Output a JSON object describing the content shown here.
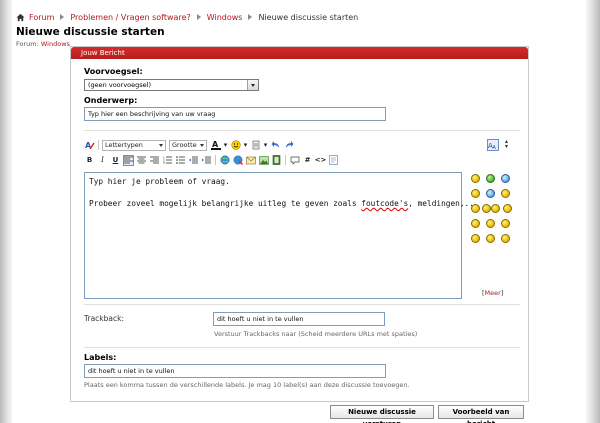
{
  "breadcrumb": {
    "items": [
      "Forum",
      "Problemen / Vragen software?",
      "Windows"
    ],
    "current": "Nieuwe discussie starten"
  },
  "page": {
    "title": "Nieuwe discussie starten",
    "forum_label": "Forum:",
    "forum_name": "Windows"
  },
  "panel": {
    "header": "Jouw Bericht"
  },
  "prefix": {
    "label": "Voorvoegsel:",
    "selected": "(geen voorvoegsel)"
  },
  "subject": {
    "label": "Onderwerp:",
    "value": "Typ hier een beschrijving van uw vraag"
  },
  "toolbar": {
    "font_select": "Lettertypen",
    "size_select": "Grootte"
  },
  "editor": {
    "line1": "Typ hier je probleem of vraag.",
    "line2_before": "Probeer zoveel mogelijk belangrijke uitleg te geven zoals ",
    "line2_misspelled": "foutcode's",
    "line2_after": ", meldingen,..."
  },
  "smilies": {
    "more_open": "[",
    "more_label": "Meer",
    "more_close": "]"
  },
  "trackback": {
    "label": "Trackback:",
    "value": "dit hoeft u niet in te vullen",
    "hint": "Verstuur Trackbacks naar (Scheid meerdere URLs met spaties)"
  },
  "labels": {
    "label": "Labels:",
    "value": "dit hoeft u niet in te vullen",
    "hint": "Plaats een komma tussen de verschillende labels. Je mag 10 label(s) aan deze discussie toevoegen."
  },
  "buttons": {
    "submit": "Nieuwe discussie versturen",
    "preview": "Voorbeeld van bericht"
  },
  "colors": {
    "accent": "#b0191e",
    "header": "#c62424"
  }
}
